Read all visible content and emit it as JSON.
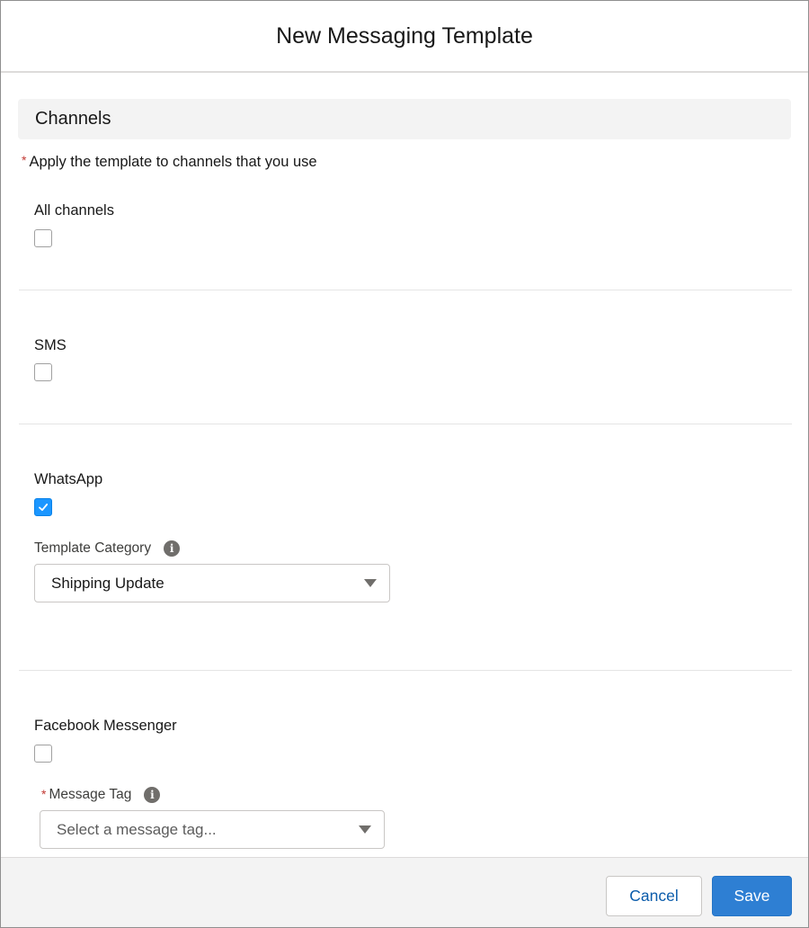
{
  "modal": {
    "title": "New Messaging Template"
  },
  "section": {
    "title": "Channels",
    "required_mark": "*",
    "instruction": "Apply the template to channels that you use"
  },
  "channels": {
    "all": {
      "label": "All channels",
      "checked": false
    },
    "sms": {
      "label": "SMS",
      "checked": false
    },
    "whatsapp": {
      "label": "WhatsApp",
      "checked": true,
      "category_label": "Template Category",
      "category_value": "Shipping Update",
      "info_glyph": "i"
    },
    "facebook": {
      "label": "Facebook Messenger",
      "checked": false,
      "tag_required_mark": "*",
      "tag_label": "Message Tag",
      "tag_placeholder": "Select a message tag...",
      "info_glyph": "i"
    }
  },
  "footer": {
    "cancel_label": "Cancel",
    "save_label": "Save"
  },
  "colors": {
    "brand": "#2e7fd3",
    "checkbox_checked": "#1b96ff",
    "required": "#c23934",
    "link": "#0b5cab"
  },
  "icons": {
    "checkmark": "check-icon",
    "info": "info-icon",
    "dropdown": "chevron-down-icon"
  }
}
